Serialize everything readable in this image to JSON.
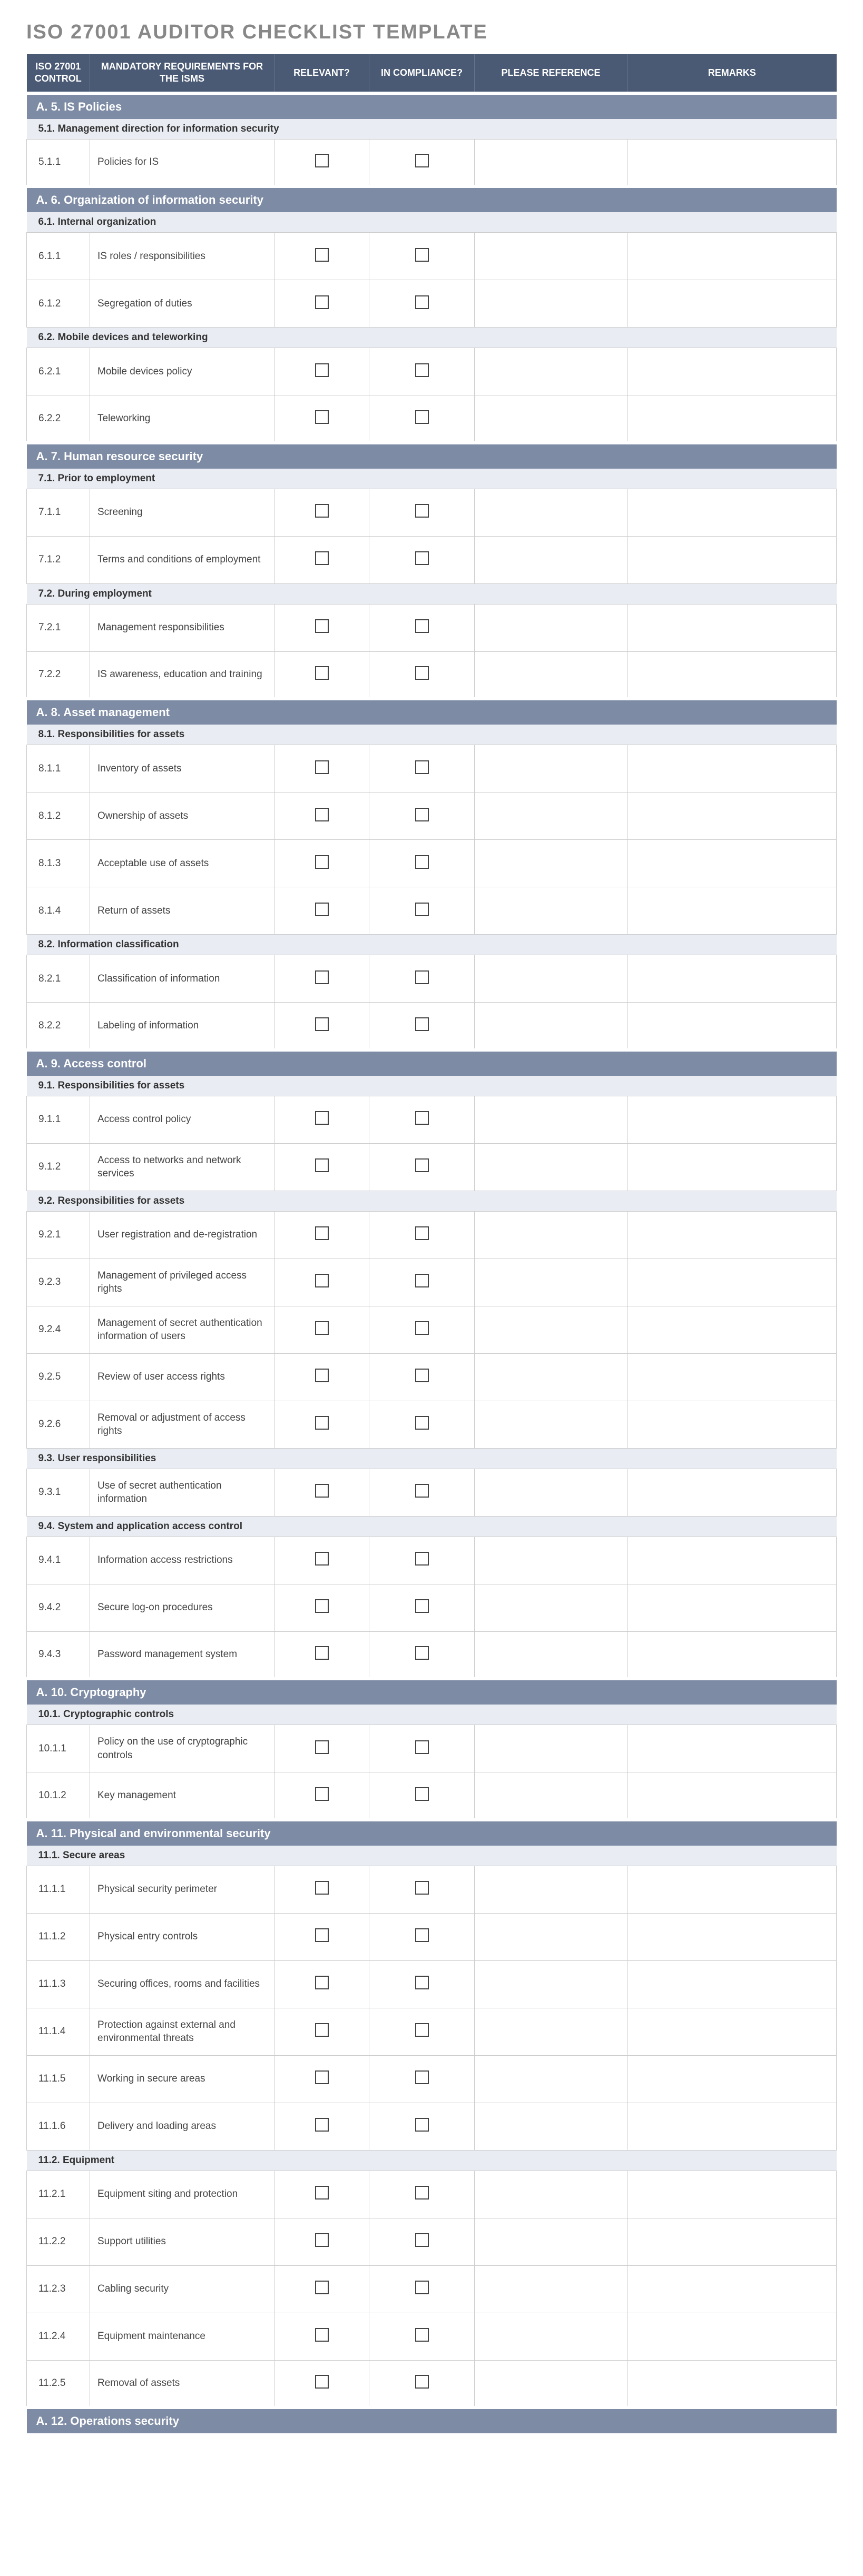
{
  "title": "ISO 27001 AUDITOR CHECKLIST TEMPLATE",
  "headers": {
    "control": "ISO 27001 CONTROL",
    "requirements": "MANDATORY REQUIREMENTS FOR THE ISMS",
    "relevant": "RELEVANT?",
    "compliance": "IN COMPLIANCE?",
    "reference": "PLEASE REFERENCE",
    "remarks": "REMARKS"
  },
  "sections": [
    {
      "title": "A. 5. IS Policies",
      "subsections": [
        {
          "title": "5.1. Management direction for information security",
          "items": [
            {
              "control": "5.1.1",
              "req": "Policies for IS"
            }
          ]
        }
      ]
    },
    {
      "title": "A. 6. Organization of information security",
      "subsections": [
        {
          "title": "6.1. Internal organization",
          "items": [
            {
              "control": "6.1.1",
              "req": "IS roles / responsibilities"
            },
            {
              "control": "6.1.2",
              "req": "Segregation of duties"
            }
          ]
        },
        {
          "title": "6.2. Mobile devices and teleworking",
          "items": [
            {
              "control": "6.2.1",
              "req": "Mobile devices policy"
            },
            {
              "control": "6.2.2",
              "req": "Teleworking"
            }
          ]
        }
      ]
    },
    {
      "title": "A. 7. Human resource security",
      "subsections": [
        {
          "title": "7.1. Prior to employment",
          "items": [
            {
              "control": "7.1.1",
              "req": "Screening"
            },
            {
              "control": "7.1.2",
              "req": "Terms and conditions of employment"
            }
          ]
        },
        {
          "title": "7.2. During employment",
          "items": [
            {
              "control": "7.2.1",
              "req": "Management responsibilities"
            },
            {
              "control": "7.2.2",
              "req": "IS awareness, education and training"
            }
          ]
        }
      ]
    },
    {
      "title": "A. 8. Asset management",
      "subsections": [
        {
          "title": "8.1. Responsibilities for assets",
          "items": [
            {
              "control": "8.1.1",
              "req": "Inventory of assets"
            },
            {
              "control": "8.1.2",
              "req": "Ownership of assets"
            },
            {
              "control": "8.1.3",
              "req": "Acceptable use of assets"
            },
            {
              "control": "8.1.4",
              "req": "Return of assets"
            }
          ]
        },
        {
          "title": "8.2. Information classification",
          "items": [
            {
              "control": "8.2.1",
              "req": "Classification of information"
            },
            {
              "control": "8.2.2",
              "req": "Labeling of information"
            }
          ]
        }
      ]
    },
    {
      "title": "A. 9. Access control",
      "subsections": [
        {
          "title": "9.1. Responsibilities for assets",
          "items": [
            {
              "control": "9.1.1",
              "req": "Access control policy"
            },
            {
              "control": "9.1.2",
              "req": "Access to networks and network services"
            }
          ]
        },
        {
          "title": "9.2. Responsibilities for assets",
          "items": [
            {
              "control": "9.2.1",
              "req": "User registration and de-registration"
            },
            {
              "control": "9.2.3",
              "req": "Management of privileged access rights"
            },
            {
              "control": "9.2.4",
              "req": "Management of secret authentication information of users"
            },
            {
              "control": "9.2.5",
              "req": "Review of user access rights"
            },
            {
              "control": "9.2.6",
              "req": "Removal or adjustment of access rights"
            }
          ]
        },
        {
          "title": "9.3. User responsibilities",
          "items": [
            {
              "control": "9.3.1",
              "req": "Use of secret authentication information"
            }
          ]
        },
        {
          "title": "9.4. System and application access control",
          "items": [
            {
              "control": "9.4.1",
              "req": "Information access restrictions"
            },
            {
              "control": "9.4.2",
              "req": "Secure log-on procedures"
            },
            {
              "control": "9.4.3",
              "req": "Password management system"
            }
          ]
        }
      ]
    },
    {
      "title": "A. 10. Cryptography",
      "subsections": [
        {
          "title": "10.1. Cryptographic controls",
          "items": [
            {
              "control": "10.1.1",
              "req": "Policy on the use of cryptographic controls"
            },
            {
              "control": "10.1.2",
              "req": "Key management"
            }
          ]
        }
      ]
    },
    {
      "title": "A. 11. Physical and environmental security",
      "subsections": [
        {
          "title": "11.1. Secure areas",
          "items": [
            {
              "control": "11.1.1",
              "req": "Physical security perimeter"
            },
            {
              "control": "11.1.2",
              "req": "Physical entry controls"
            },
            {
              "control": "11.1.3",
              "req": "Securing offices, rooms and facilities"
            },
            {
              "control": "11.1.4",
              "req": "Protection against external and environmental threats"
            },
            {
              "control": "11.1.5",
              "req": "Working in secure areas"
            },
            {
              "control": "11.1.6",
              "req": "Delivery and loading areas"
            }
          ]
        },
        {
          "title": "11.2. Equipment",
          "items": [
            {
              "control": "11.2.1",
              "req": "Equipment siting and protection"
            },
            {
              "control": "11.2.2",
              "req": "Support utilities"
            },
            {
              "control": "11.2.3",
              "req": "Cabling security"
            },
            {
              "control": "11.2.4",
              "req": "Equipment maintenance"
            },
            {
              "control": "11.2.5",
              "req": "Removal of assets"
            }
          ]
        }
      ]
    },
    {
      "title": "A. 12. Operations security",
      "subsections": []
    }
  ]
}
